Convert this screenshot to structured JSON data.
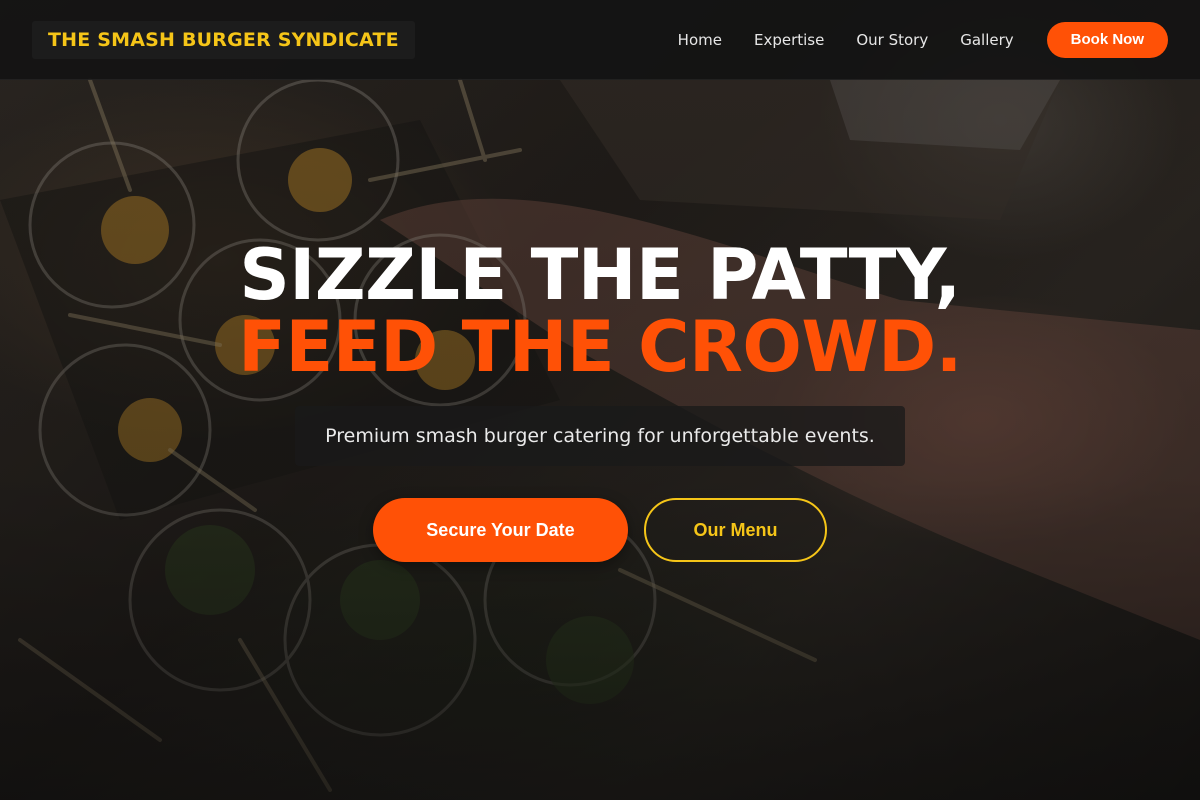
{
  "nav": {
    "brand": "THE SMASH BURGER SYNDICATE",
    "links": [
      "Home",
      "Expertise",
      "Our Story",
      "Gallery"
    ],
    "cta": "Book Now"
  },
  "hero": {
    "headline_line1": "SIZZLE THE PATTY,",
    "headline_line2": "FEED THE CROWD.",
    "tagline": "Premium smash burger catering for unforgettable events.",
    "primary_button": "Secure Your Date",
    "secondary_button": "Our Menu",
    "background_image": "catering-food-cups-photo"
  },
  "colors": {
    "brand_yellow": "#f5c518",
    "accent_orange": "#ff5106",
    "nav_background": "#141414",
    "text_white": "#ffffff"
  }
}
